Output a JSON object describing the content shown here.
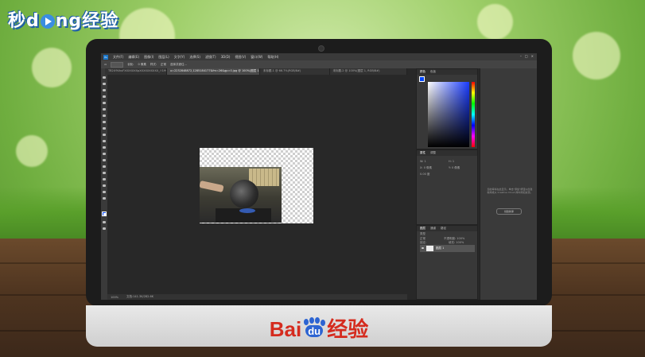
{
  "watermark_top": {
    "prefix": "秒",
    "mid": "ng",
    "suffix": "经验",
    "d": "d"
  },
  "monitor_brand": {
    "bai": "Bai",
    "du": "du",
    "jingyan": "经验"
  },
  "ps": {
    "app_icon": "Ps",
    "menu": [
      "文件(F)",
      "编辑(E)",
      "图像(I)",
      "图层(L)",
      "文字(Y)",
      "选择(S)",
      "滤镜(T)",
      "3D(D)",
      "视图(V)",
      "窗口(W)",
      "帮助(H)"
    ],
    "window_controls": [
      "–",
      "□",
      "×"
    ],
    "options": {
      "feather_label": "羽化:",
      "feather_value": "0 像素",
      "style_label": "样式:",
      "style_value": "正常",
      "select_btn": "选择并遮住..."
    },
    "tabs": [
      {
        "label": "TB2U9UkuFXXXXXXXpXXXXXXXXXX_!!1993299995.jpg @ 100%(图层 1, RGB/8#)"
      },
      {
        "label": "u=2232848872,1285184177&fm=26&gp=0.jpg @ 100%(图层 1, RGB/8#)",
        "active": true
      },
      {
        "label": "未标题-1 @ 66.7%(RGB/8#)"
      },
      {
        "label": "未标题-2 @ 100%(图层 1, RGB/8#)"
      }
    ],
    "status": {
      "zoom": "100%",
      "doc": "文档:141.3K/282.6K"
    },
    "color_panel": {
      "tabs": [
        "颜色",
        "色板"
      ]
    },
    "properties_panel": {
      "tabs": [
        "属性",
        "调整"
      ],
      "fields": [
        "W: 1",
        "H: 1",
        "X: 0 像素",
        "Y: 0 像素",
        "0.00 度"
      ]
    },
    "layers_panel": {
      "tabs": [
        "图层",
        "通道",
        "路径"
      ],
      "kind": "类型",
      "blend": "正常",
      "opacity": "不透明度: 100%",
      "lock": "锁定:",
      "fill": "填充: 100%",
      "layer_name": "图层 1"
    },
    "libraries": {
      "message": "您的库将在此显示。单击\"添加\"按钮以创建新库或从 Creative Cloud 库中添加资源。",
      "button": "创建新库"
    }
  },
  "colors": {
    "ps_blue": "#1b76c9",
    "baidu_red": "#d52b1e",
    "baidu_blue": "#2c64d2",
    "foreground": "#0046ff"
  }
}
